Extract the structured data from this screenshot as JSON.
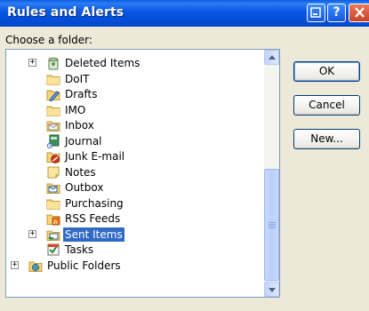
{
  "window": {
    "title": "Rules and Alerts"
  },
  "prompt": "Choose a folder:",
  "folders": [
    {
      "label": "Deleted Items",
      "icon": "deleted-items-icon",
      "expander": "+"
    },
    {
      "label": "DoIT",
      "icon": "folder-icon"
    },
    {
      "label": "Drafts",
      "icon": "drafts-icon"
    },
    {
      "label": "IMO",
      "icon": "folder-icon"
    },
    {
      "label": "Inbox",
      "icon": "inbox-icon"
    },
    {
      "label": "Journal",
      "icon": "journal-icon"
    },
    {
      "label": "Junk E-mail",
      "icon": "junk-email-icon"
    },
    {
      "label": "Notes",
      "icon": "notes-icon"
    },
    {
      "label": "Outbox",
      "icon": "outbox-icon"
    },
    {
      "label": "Purchasing",
      "icon": "folder-icon"
    },
    {
      "label": "RSS Feeds",
      "icon": "rss-feeds-icon"
    },
    {
      "label": "Sent Items",
      "icon": "sent-items-icon",
      "expander": "+",
      "selected": true
    },
    {
      "label": "Tasks",
      "icon": "tasks-icon"
    },
    {
      "label": "Public Folders",
      "icon": "public-folders-icon",
      "expander": "+"
    }
  ],
  "buttons": {
    "ok": "OK",
    "cancel": "Cancel",
    "new": "New..."
  },
  "colors": {
    "selection": "#316ac5",
    "titlebar": "#0655e4"
  }
}
